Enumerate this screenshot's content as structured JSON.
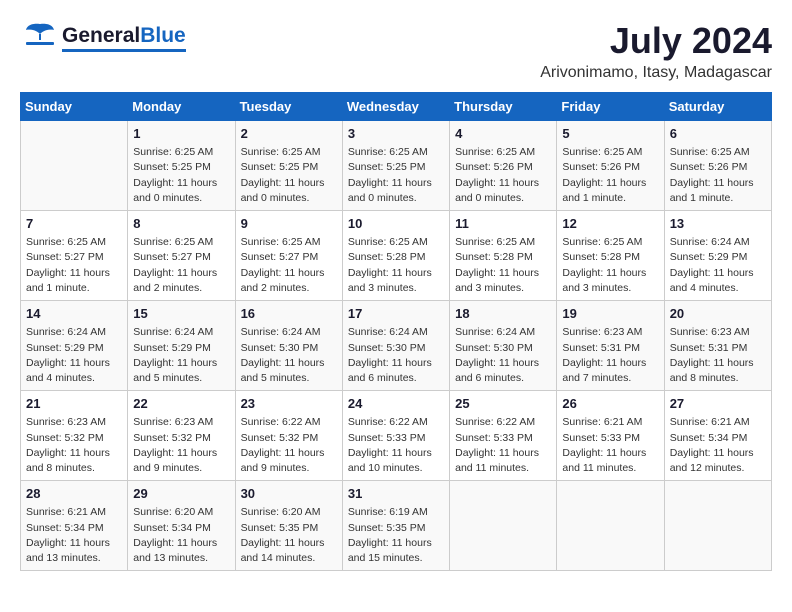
{
  "header": {
    "logo_general": "General",
    "logo_blue": "Blue",
    "month_year": "July 2024",
    "location": "Arivonimamo, Itasy, Madagascar"
  },
  "calendar": {
    "days_of_week": [
      "Sunday",
      "Monday",
      "Tuesday",
      "Wednesday",
      "Thursday",
      "Friday",
      "Saturday"
    ],
    "weeks": [
      [
        {
          "day": "",
          "info": ""
        },
        {
          "day": "1",
          "info": "Sunrise: 6:25 AM\nSunset: 5:25 PM\nDaylight: 11 hours\nand 0 minutes."
        },
        {
          "day": "2",
          "info": "Sunrise: 6:25 AM\nSunset: 5:25 PM\nDaylight: 11 hours\nand 0 minutes."
        },
        {
          "day": "3",
          "info": "Sunrise: 6:25 AM\nSunset: 5:25 PM\nDaylight: 11 hours\nand 0 minutes."
        },
        {
          "day": "4",
          "info": "Sunrise: 6:25 AM\nSunset: 5:26 PM\nDaylight: 11 hours\nand 0 minutes."
        },
        {
          "day": "5",
          "info": "Sunrise: 6:25 AM\nSunset: 5:26 PM\nDaylight: 11 hours\nand 1 minute."
        },
        {
          "day": "6",
          "info": "Sunrise: 6:25 AM\nSunset: 5:26 PM\nDaylight: 11 hours\nand 1 minute."
        }
      ],
      [
        {
          "day": "7",
          "info": "Sunrise: 6:25 AM\nSunset: 5:27 PM\nDaylight: 11 hours\nand 1 minute."
        },
        {
          "day": "8",
          "info": "Sunrise: 6:25 AM\nSunset: 5:27 PM\nDaylight: 11 hours\nand 2 minutes."
        },
        {
          "day": "9",
          "info": "Sunrise: 6:25 AM\nSunset: 5:27 PM\nDaylight: 11 hours\nand 2 minutes."
        },
        {
          "day": "10",
          "info": "Sunrise: 6:25 AM\nSunset: 5:28 PM\nDaylight: 11 hours\nand 3 minutes."
        },
        {
          "day": "11",
          "info": "Sunrise: 6:25 AM\nSunset: 5:28 PM\nDaylight: 11 hours\nand 3 minutes."
        },
        {
          "day": "12",
          "info": "Sunrise: 6:25 AM\nSunset: 5:28 PM\nDaylight: 11 hours\nand 3 minutes."
        },
        {
          "day": "13",
          "info": "Sunrise: 6:24 AM\nSunset: 5:29 PM\nDaylight: 11 hours\nand 4 minutes."
        }
      ],
      [
        {
          "day": "14",
          "info": "Sunrise: 6:24 AM\nSunset: 5:29 PM\nDaylight: 11 hours\nand 4 minutes."
        },
        {
          "day": "15",
          "info": "Sunrise: 6:24 AM\nSunset: 5:29 PM\nDaylight: 11 hours\nand 5 minutes."
        },
        {
          "day": "16",
          "info": "Sunrise: 6:24 AM\nSunset: 5:30 PM\nDaylight: 11 hours\nand 5 minutes."
        },
        {
          "day": "17",
          "info": "Sunrise: 6:24 AM\nSunset: 5:30 PM\nDaylight: 11 hours\nand 6 minutes."
        },
        {
          "day": "18",
          "info": "Sunrise: 6:24 AM\nSunset: 5:30 PM\nDaylight: 11 hours\nand 6 minutes."
        },
        {
          "day": "19",
          "info": "Sunrise: 6:23 AM\nSunset: 5:31 PM\nDaylight: 11 hours\nand 7 minutes."
        },
        {
          "day": "20",
          "info": "Sunrise: 6:23 AM\nSunset: 5:31 PM\nDaylight: 11 hours\nand 8 minutes."
        }
      ],
      [
        {
          "day": "21",
          "info": "Sunrise: 6:23 AM\nSunset: 5:32 PM\nDaylight: 11 hours\nand 8 minutes."
        },
        {
          "day": "22",
          "info": "Sunrise: 6:23 AM\nSunset: 5:32 PM\nDaylight: 11 hours\nand 9 minutes."
        },
        {
          "day": "23",
          "info": "Sunrise: 6:22 AM\nSunset: 5:32 PM\nDaylight: 11 hours\nand 9 minutes."
        },
        {
          "day": "24",
          "info": "Sunrise: 6:22 AM\nSunset: 5:33 PM\nDaylight: 11 hours\nand 10 minutes."
        },
        {
          "day": "25",
          "info": "Sunrise: 6:22 AM\nSunset: 5:33 PM\nDaylight: 11 hours\nand 11 minutes."
        },
        {
          "day": "26",
          "info": "Sunrise: 6:21 AM\nSunset: 5:33 PM\nDaylight: 11 hours\nand 11 minutes."
        },
        {
          "day": "27",
          "info": "Sunrise: 6:21 AM\nSunset: 5:34 PM\nDaylight: 11 hours\nand 12 minutes."
        }
      ],
      [
        {
          "day": "28",
          "info": "Sunrise: 6:21 AM\nSunset: 5:34 PM\nDaylight: 11 hours\nand 13 minutes."
        },
        {
          "day": "29",
          "info": "Sunrise: 6:20 AM\nSunset: 5:34 PM\nDaylight: 11 hours\nand 13 minutes."
        },
        {
          "day": "30",
          "info": "Sunrise: 6:20 AM\nSunset: 5:35 PM\nDaylight: 11 hours\nand 14 minutes."
        },
        {
          "day": "31",
          "info": "Sunrise: 6:19 AM\nSunset: 5:35 PM\nDaylight: 11 hours\nand 15 minutes."
        },
        {
          "day": "",
          "info": ""
        },
        {
          "day": "",
          "info": ""
        },
        {
          "day": "",
          "info": ""
        }
      ]
    ]
  }
}
